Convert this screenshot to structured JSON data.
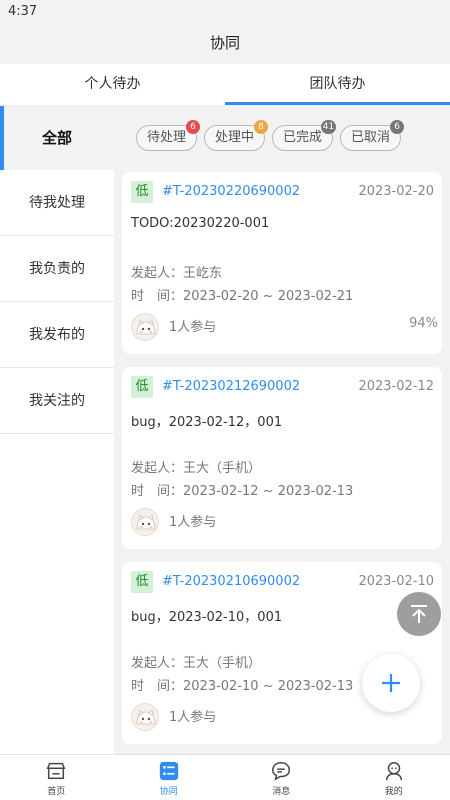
{
  "status_bar": {
    "time": "4:37"
  },
  "header": {
    "title": "协同"
  },
  "top_tabs": [
    {
      "label": "个人待办",
      "active": false
    },
    {
      "label": "团队待办",
      "active": true
    }
  ],
  "sidebar": {
    "all_label": "全部",
    "items": [
      {
        "label": "待我处理"
      },
      {
        "label": "我负责的"
      },
      {
        "label": "我发布的"
      },
      {
        "label": "我关注的"
      }
    ]
  },
  "filters": [
    {
      "label": "待处理",
      "count": "6",
      "badge_color": "#e84b4b"
    },
    {
      "label": "处理中",
      "count": "8",
      "badge_color": "#f0a640"
    },
    {
      "label": "已完成",
      "count": "41",
      "badge_color": "#777777"
    },
    {
      "label": "已取消",
      "count": "6",
      "badge_color": "#777777"
    }
  ],
  "cards": [
    {
      "priority": "低",
      "task_no": "#T-20230220690002",
      "date": "2023-02-20",
      "title": "TODO:20230220-001",
      "initiator": "发起人：王屹东",
      "time": "时　间：2023-02-20 ~ 2023-02-21",
      "participants": "1人参与",
      "percent": "94%"
    },
    {
      "priority": "低",
      "task_no": "#T-20230212690002",
      "date": "2023-02-12",
      "title": "bug，2023-02-12，001",
      "initiator": "发起人：王大（手机）",
      "time": "时　间：2023-02-12 ~ 2023-02-13",
      "participants": "1人参与",
      "percent": ""
    },
    {
      "priority": "低",
      "task_no": "#T-20230210690002",
      "date": "2023-02-10",
      "title": "bug，2023-02-10，001",
      "initiator": "发起人：王大（手机）",
      "time": "时　间：2023-02-10 ~ 2023-02-13",
      "participants": "1人参与",
      "percent": ""
    }
  ],
  "bottom_nav": [
    {
      "label": "首页",
      "icon": "store-icon",
      "active": false
    },
    {
      "label": "协同",
      "icon": "checklist-icon",
      "active": true
    },
    {
      "label": "消息",
      "icon": "chat-bubble-icon",
      "active": false
    },
    {
      "label": "我的",
      "icon": "user-icon",
      "active": false
    }
  ],
  "colors": {
    "accent": "#2f8cf0",
    "priority_bg": "#d4f0d6",
    "priority_text": "#1a8a2a"
  },
  "fab_icon": "plus-icon",
  "back_top_icon": "arrow-up-to-top-icon"
}
